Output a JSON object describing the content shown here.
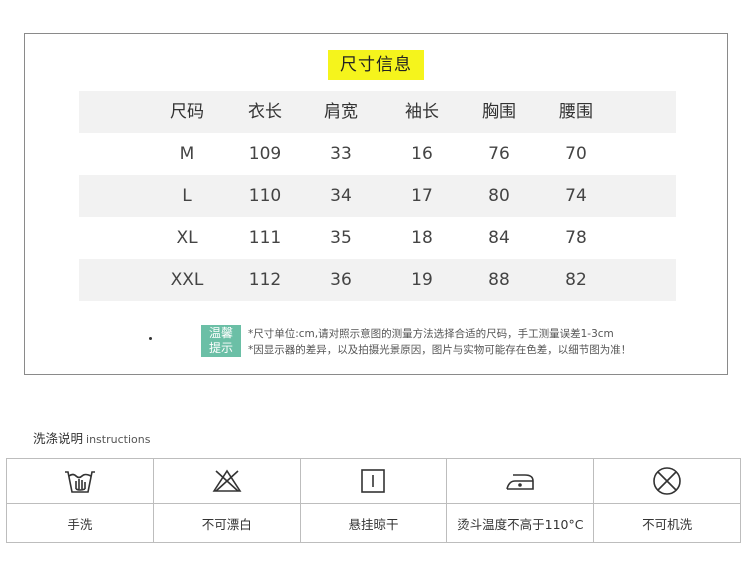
{
  "size_info": {
    "title": "尺寸信息",
    "columns": [
      "尺码",
      "衣长",
      "肩宽",
      "袖长",
      "胸围",
      "腰围"
    ],
    "rows": [
      [
        "M",
        "109",
        "33",
        "16",
        "76",
        "70"
      ],
      [
        "L",
        "110",
        "34",
        "17",
        "80",
        "74"
      ],
      [
        "XL",
        "111",
        "35",
        "18",
        "84",
        "78"
      ],
      [
        "XXL",
        "112",
        "36",
        "19",
        "88",
        "82"
      ]
    ],
    "tip_badge": "温馨提示",
    "tip_lines": [
      "*尺寸单位:cm,请对照示意图的测量方法选择合适的尺码，手工测量误差1-3cm",
      "*因显示器的差异，以及拍摄光景原因，图片与实物可能存在色差，以细节图为准！"
    ]
  },
  "wash": {
    "title": "洗涤说明",
    "title_en": "instructions",
    "items": [
      {
        "icon": "hand-wash-icon",
        "label": "手洗"
      },
      {
        "icon": "no-bleach-icon",
        "label": "不可漂白"
      },
      {
        "icon": "hang-dry-icon",
        "label": "悬挂晾干"
      },
      {
        "icon": "iron-icon",
        "label": "烫斗温度不高于110°C"
      },
      {
        "icon": "no-machine-wash-icon",
        "label": "不可机洗"
      }
    ]
  },
  "colors": {
    "title_highlight": "#f5f41c",
    "tip_badge_bg": "#6bbfa6",
    "row_shade": "#f2f2f2"
  }
}
